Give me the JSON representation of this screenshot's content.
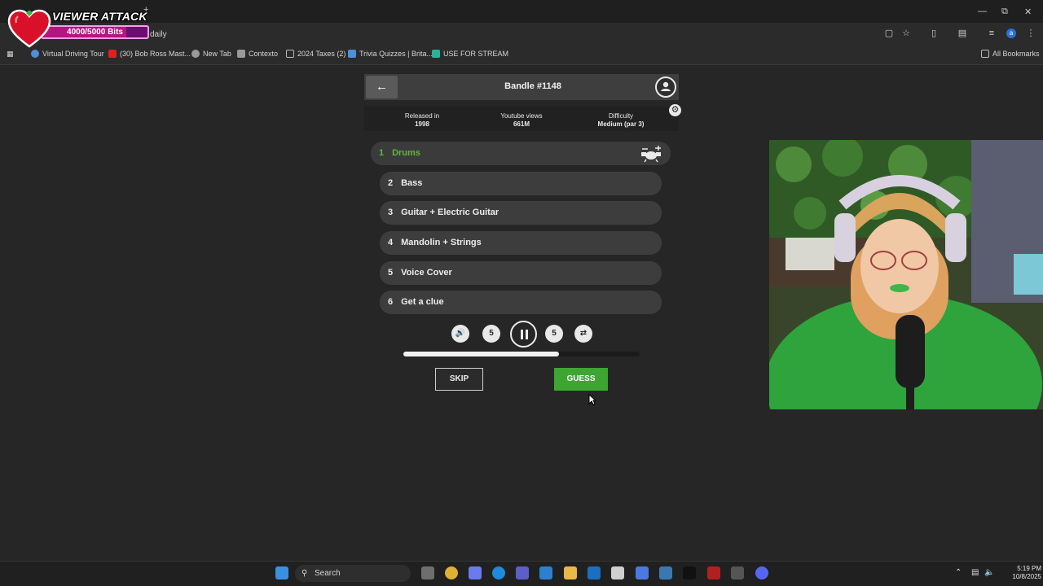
{
  "browser": {
    "address_text": "daily",
    "bookmarks": [
      {
        "label": "Virtual Driving Tour",
        "color": "#4f8fd8"
      },
      {
        "label": "(30) Bob Ross Mast...",
        "color": "#e02020"
      },
      {
        "label": "New Tab",
        "color": "#9a9a9a"
      },
      {
        "label": "Contexto",
        "color": "#9a9a9a"
      },
      {
        "label": "2024 Taxes (2)",
        "color": "#9a9a9a"
      },
      {
        "label": "Trivia Quizzes | Brita...",
        "color": "#4f8fd8"
      },
      {
        "label": "USE FOR STREAM",
        "color": "#2bb39a"
      }
    ],
    "all_bookmarks_label": "All Bookmarks"
  },
  "overlay": {
    "title": "VIEWER ATTACK",
    "bits_text": "4000/5000 Bits",
    "bits_progress": 0.8
  },
  "game": {
    "title": "Bandle #1148",
    "info": {
      "released_label": "Released in",
      "released_value": "1998",
      "views_label": "Youtube views",
      "views_value": "661M",
      "difficulty_label": "Difficulty",
      "difficulty_value": "Medium (par 3)"
    },
    "tracks": [
      {
        "num": "1",
        "label": "Drums"
      },
      {
        "num": "2",
        "label": "Bass"
      },
      {
        "num": "3",
        "label": "Guitar + Electric Guitar"
      },
      {
        "num": "4",
        "label": "Mandolin + Strings"
      },
      {
        "num": "5",
        "label": "Voice Cover"
      },
      {
        "num": "6",
        "label": "Get a clue"
      }
    ],
    "controls": {
      "rewind_label": "5",
      "forward_label": "5"
    },
    "progress": 0.66,
    "skip_label": "SKIP",
    "guess_label": "GUESS"
  },
  "taskbar": {
    "search_label": "Search",
    "time": "5:19 PM",
    "date": "10/8/2025"
  }
}
